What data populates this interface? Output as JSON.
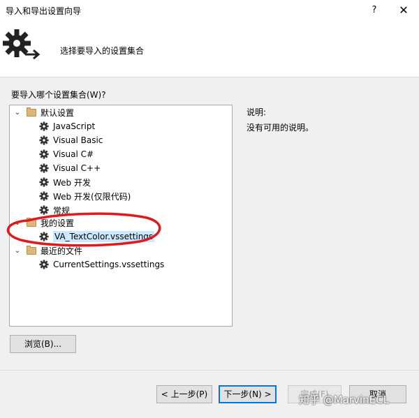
{
  "window": {
    "title": "导入和导出设置向导",
    "help_label": "?",
    "close_label": "✕"
  },
  "header": {
    "title": "选择要导入的设置集合"
  },
  "tree": {
    "label": "要导入哪个设置集合(W)?",
    "groups": [
      {
        "label": "默认设置",
        "expanded": true,
        "items": [
          "JavaScript",
          "Visual Basic",
          "Visual C#",
          "Visual C++",
          "Web 开发",
          "Web 开发(仅限代码)",
          "常规"
        ]
      },
      {
        "label": "我的设置",
        "expanded": true,
        "items": [
          "VA_TextColor.vssettings"
        ],
        "selected_index": 0
      },
      {
        "label": "最近的文件",
        "expanded": true,
        "items": [
          "CurrentSettings.vssettings"
        ]
      }
    ]
  },
  "description": {
    "label": "说明:",
    "text": "没有可用的说明。"
  },
  "buttons": {
    "browse": "浏览(B)...",
    "prev": "< 上一步(P)",
    "next": "下一步(N) >",
    "finish": "完成(F)",
    "cancel": "取消"
  },
  "watermark": "知乎 @MarvinECL",
  "colors": {
    "selection": "#cce8ff",
    "default_button_border": "#0078d7",
    "annotation": "#e0191b"
  }
}
